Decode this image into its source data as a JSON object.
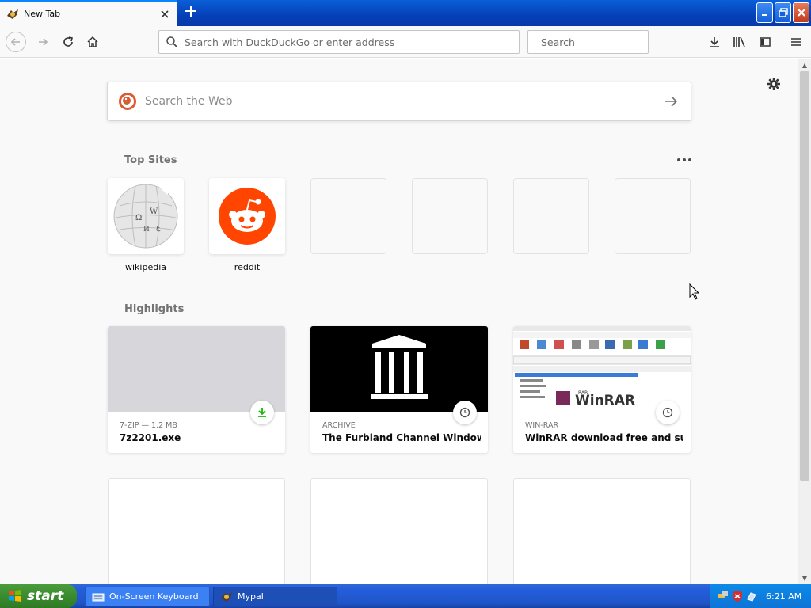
{
  "tab": {
    "title": "New Tab",
    "close_icon": "close-icon"
  },
  "toolbar": {
    "url_placeholder": "Search with DuckDuckGo or enter address",
    "search_placeholder": "Search"
  },
  "content": {
    "web_search_placeholder": "Search the Web",
    "top_sites_title": "Top Sites",
    "top_sites": [
      {
        "label": "wikipedia",
        "empty": false
      },
      {
        "label": "reddit",
        "empty": false
      },
      {
        "label": "",
        "empty": true
      },
      {
        "label": "",
        "empty": true
      },
      {
        "label": "",
        "empty": true
      },
      {
        "label": "",
        "empty": true
      }
    ],
    "highlights_title": "Highlights",
    "highlights": [
      {
        "context": "7-ZIP — 1.2 MB",
        "title": "7z2201.exe",
        "badge": "download-icon"
      },
      {
        "context": "ARCHIVE",
        "title": "The Furbland Channel Windows…",
        "badge": "clock-icon"
      },
      {
        "context": "WIN-RAR",
        "title": "WinRAR download free and sup…",
        "badge": "clock-icon"
      }
    ]
  },
  "taskbar": {
    "start_label": "start",
    "tasks": [
      {
        "label": "On-Screen Keyboard"
      },
      {
        "label": "Mypal"
      }
    ],
    "clock": "6:21 AM"
  },
  "colors": {
    "accent": "#0a84ff",
    "reddit": "#ff4500",
    "download_green": "#12bc00"
  }
}
